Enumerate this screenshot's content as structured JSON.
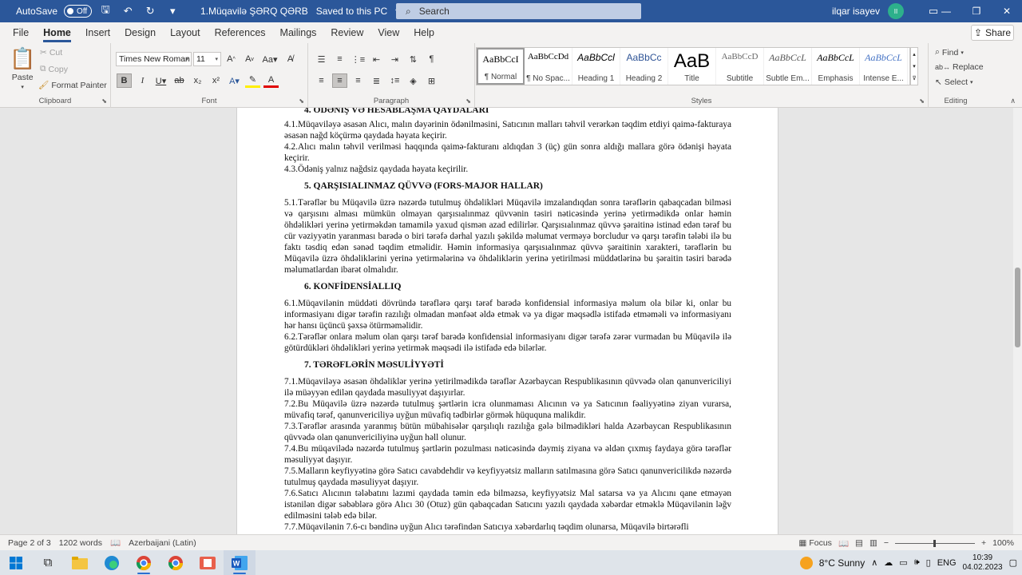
{
  "titlebar": {
    "autosave_label": "AutoSave",
    "autosave_state": "Off",
    "doc_title": "1.Müqavilə ŞƏRQ QƏRB",
    "save_status": "Saved to this PC",
    "search_placeholder": "Search",
    "user_name": "ilqar isayev",
    "user_initials": "II"
  },
  "menu": {
    "items": [
      "File",
      "Home",
      "Insert",
      "Design",
      "Layout",
      "References",
      "Mailings",
      "Review",
      "View",
      "Help"
    ],
    "active": "Home",
    "share": "Share"
  },
  "ribbon": {
    "clipboard": {
      "label": "Clipboard",
      "paste": "Paste",
      "cut": "Cut",
      "copy": "Copy",
      "format_painter": "Format Painter"
    },
    "font": {
      "label": "Font",
      "family": "Times New Roman",
      "size": "11"
    },
    "paragraph": {
      "label": "Paragraph"
    },
    "styles": {
      "label": "Styles",
      "items": [
        {
          "sample": "AaBbCcI",
          "name": "¶ Normal"
        },
        {
          "sample": "AaBbCcDd",
          "name": "¶ No Spac..."
        },
        {
          "sample": "AaBbCcl",
          "name": "Heading 1"
        },
        {
          "sample": "AaBbCc",
          "name": "Heading 2"
        },
        {
          "sample": "AaB",
          "name": "Title"
        },
        {
          "sample": "AaBbCcD",
          "name": "Subtitle"
        },
        {
          "sample": "AaBbCcL",
          "name": "Subtle Em..."
        },
        {
          "sample": "AaBbCcL",
          "name": "Emphasis"
        },
        {
          "sample": "AaBbCcL",
          "name": "Intense E..."
        }
      ]
    },
    "editing": {
      "label": "Editing",
      "find": "Find",
      "replace": "Replace",
      "select": "Select"
    }
  },
  "document": {
    "h4": "4. ÖDƏNİŞ VƏ HESABLAŞMA QAYDALARI",
    "p4_1": "4.1.Müqaviləyə əsasən Alıcı, malın dəyərinin ödənilməsini, Satıcının malları təhvil verərkən təqdim etdiyi qaimə-fakturaya əsasən nağd köçürmə qaydada həyata keçirir.",
    "p4_2": "4.2.Alıcı malın təhvil verilməsi haqqında qaimə-fakturanı aldıqdan 3 (üç) gün sonra aldığı mallara görə ödənişi həyata keçirir.",
    "p4_3": "4.3.Ödəniş yalnız nağdsiz qaydada həyata keçirilir.",
    "h5": "5. QARŞISIALINMAZ QÜVVƏ (FORS-MAJOR HALLAR)",
    "p5_1": "5.1.Tərəflər bu Müqavilə üzrə nəzərdə tutulmuş öhdəlikləri Müqavilə imzalandıqdan sonra tərəflərin qabaqcadan bilməsi və qarşısını alması mümkün olmayan qarşısıalınmaz qüvvənin təsiri nəticəsində yerinə yetirmədikdə onlar həmin öhdəlikləri yerinə yetirməkdən tamamilə yaxud qismən azad edilirlər. Qarşısıalınmaz qüvvə şəraitinə istinad edən tərəf bu cür vəziyyətin yaranması barədə o biri tərəfə dərhal yazılı şəkildə məlumat verməyə borcludur və qarşı tərəfin tələbi ilə bu faktı təsdiq edən sənəd təqdim etməlidir. Həmin informasiya qarşısıalınmaz qüvvə şəraitinin xarakteri, tərəflərin bu Müqavilə üzrə öhdəliklərini yerinə yetirmələrinə və öhdəliklərin yerinə yetirilməsi müddətlərinə bu şəraitin təsiri barədə məlumatlardan ibarət olmalıdır.",
    "h6": "6. KONFİDENSİALLIQ",
    "p6_1": "6.1.Müqavilənin müddəti dövründə tərəflərə qarşı tərəf barədə konfidensial informasiya məlum ola bilər ki, onlar bu informasiyanı digər tərəfin razılığı olmadan mənfəət əldə etmək və ya digər məqsədlə istifadə etməməli və informasiyanı hər hansı üçüncü şəxsə ötürməməlidir.",
    "p6_2": "6.2.Tərəflər onlara məlum olan qarşı tərəf barədə konfidensial informasiyanı digər tərəfə zərər vurmadan bu Müqavilə ilə götürdükləri öhdəlikləri yerinə yetirmək məqsədi ilə istifadə edə bilərlər.",
    "h7": "7. TƏRƏFLƏRİN MƏSULİYYƏTİ",
    "p7_1": "7.1.Müqaviləyə əsasən öhdəliklər yerinə yetirilmədikdə tərəflər Azərbaycan Respublikasının qüvvədə olan qanunvericiliyi ilə müəyyən edilən qaydada məsuliyyət daşıyırlar.",
    "p7_2": "7.2.Bu Müqavilə üzrə nəzərdə tutulmuş şərtlərin icra olunmaması Alıcının və ya Satıcının fəaliyyətinə ziyan vurarsa, müvafiq tərəf, qanunvericiliyə uyğun müvafiq tədbirlər görmək hüququna malikdir.",
    "p7_3": "7.3.Tərəflər arasında yaranmış bütün mübahisələr qarşılıqlı razılığa gələ bilmədikləri halda Azərbaycan Respublikasının qüvvədə olan qanunvericiliyinə uyğun həll olunur.",
    "p7_4": "7.4.Bu müqavilədə nəzərdə tutulmuş şərtlərin pozulması nəticəsində dəymiş ziyana və əldən çıxmış faydaya görə tərəflər məsuliyyət daşıyır.",
    "p7_5": "7.5.Malların keyfiyyətinə görə Satıcı cavabdehdir və keyfiyyətsiz malların satılmasına görə Satıcı qanunvericilikdə nəzərdə tutulmuş qaydada məsuliyyət daşıyır.",
    "p7_6": "7.6.Satıcı Alıcının tələbatını lazımi qaydada təmin edə bilməzsə, keyfiyyətsiz Mal satarsa və ya Alıcını qane etməyən istənilən digər səbəblərə görə Alıcı 30 (Otuz) gün qabaqcadan Satıcını yazılı qaydada xəbərdar etməklə Müqavilənin ləğv edilməsini tələb edə bilər.",
    "p7_7": "7.7.Müqavilənin 7.6-cı bəndinə uyğun Alıcı tərəfindən Satıcıya xəbərdarlıq təqdim olunarsa, Müqavilə birtərəfli"
  },
  "status": {
    "page": "Page 2 of 3",
    "words": "1202 words",
    "language": "Azerbaijani (Latin)",
    "focus": "Focus",
    "zoom": "100%"
  },
  "taskbar": {
    "weather": "8°C  Sunny",
    "lang": "ENG",
    "time": "10:39",
    "date": "04.02.2023"
  }
}
